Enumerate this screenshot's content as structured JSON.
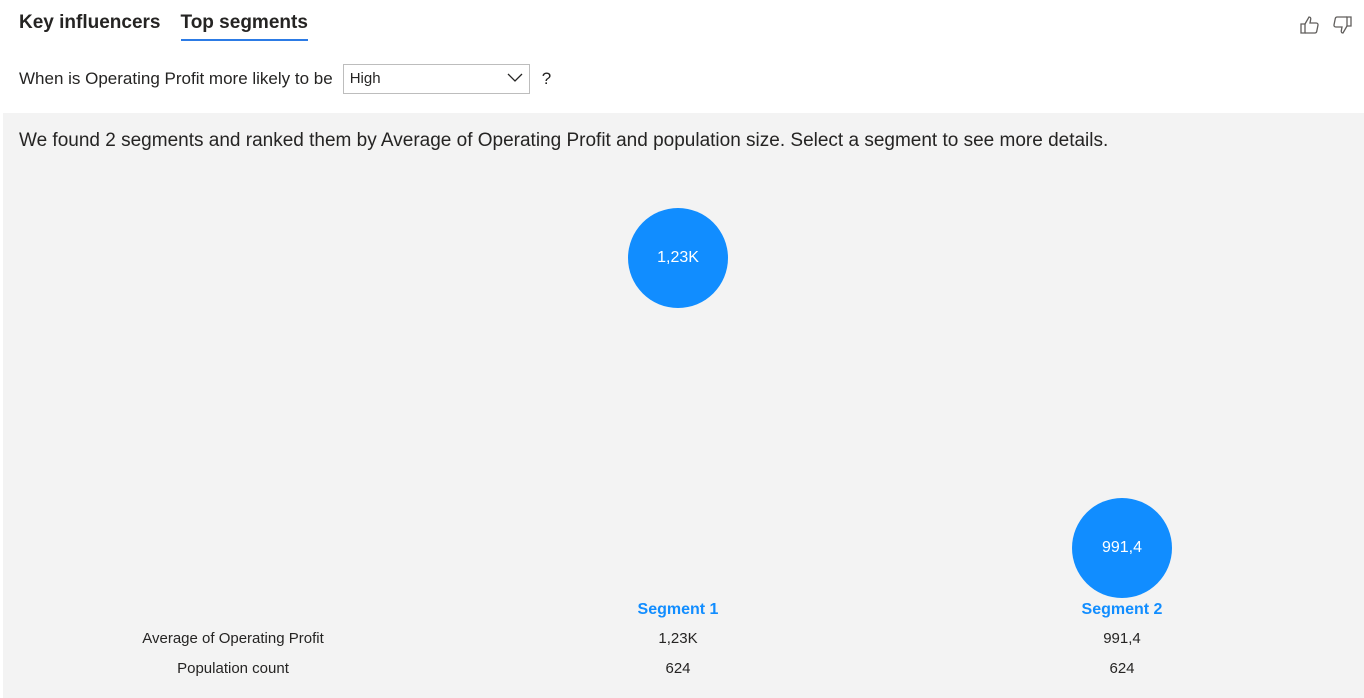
{
  "tabs": [
    {
      "label": "Key influencers",
      "active": false
    },
    {
      "label": "Top segments",
      "active": true
    }
  ],
  "question": {
    "prefix": "When is Operating Profit more likely to be",
    "selected": "High",
    "suffix": "?"
  },
  "summary": "We found 2 segments and ranked them by Average of Operating Profit and population size. Select a segment to see more details.",
  "accent_color": "#118dff",
  "icons": [
    "thumbs-up-icon",
    "thumbs-down-icon",
    "chevron-down-icon"
  ],
  "segments": [
    {
      "name": "Segment 1",
      "bubble_label": "1,23K",
      "average": "1,23K",
      "population": "624"
    },
    {
      "name": "Segment 2",
      "bubble_label": "991,4",
      "average": "991,4",
      "population": "624"
    }
  ],
  "row_labels": {
    "average": "Average of Operating Profit",
    "population": "Population count"
  }
}
